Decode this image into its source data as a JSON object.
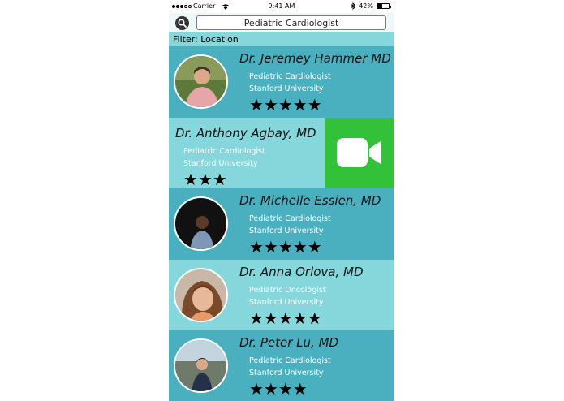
{
  "status_bar": {
    "carrier": "Carrier",
    "time": "9:41 AM",
    "battery": "42%",
    "battery_level": 0.42
  },
  "search": {
    "query": "Pediatric Cardiologist",
    "icon": "search-icon"
  },
  "filter": {
    "label": "Filter: Location"
  },
  "doctors": [
    {
      "name": "Dr. Jeremey Hammer MD",
      "specialty": "Pediatric Cardiologist",
      "school": "Stanford University",
      "rating": 5,
      "stars_text": "★★★★★"
    },
    {
      "name": "Dr. Anthony Agbay, MD",
      "specialty": "Pediatric Cardiologist",
      "school": "Stanford University",
      "rating": 3,
      "stars_text": "★★★"
    },
    {
      "name": "Dr. Michelle Essien, MD",
      "specialty": "Pediatric Cardiologist",
      "school": "Stanford University",
      "rating": 5,
      "stars_text": "★★★★★"
    },
    {
      "name": "Dr. Anna Orlova, MD",
      "specialty": "Pediatric Oncologist",
      "school": "Stanford University",
      "rating": 5,
      "stars_text": "★★★★★"
    },
    {
      "name": "Dr. Peter Lu, MD",
      "specialty": "Pediatric Cardiologist",
      "school": "Stanford University",
      "rating": 4,
      "stars_text": "★★★★"
    }
  ],
  "video_call": {
    "icon": "video-camera-icon"
  },
  "colors": {
    "row_dark": "#4ab0c0",
    "row_light": "#85d7dc",
    "video_green": "#33c13a",
    "search_bg": "#eef8f9"
  }
}
